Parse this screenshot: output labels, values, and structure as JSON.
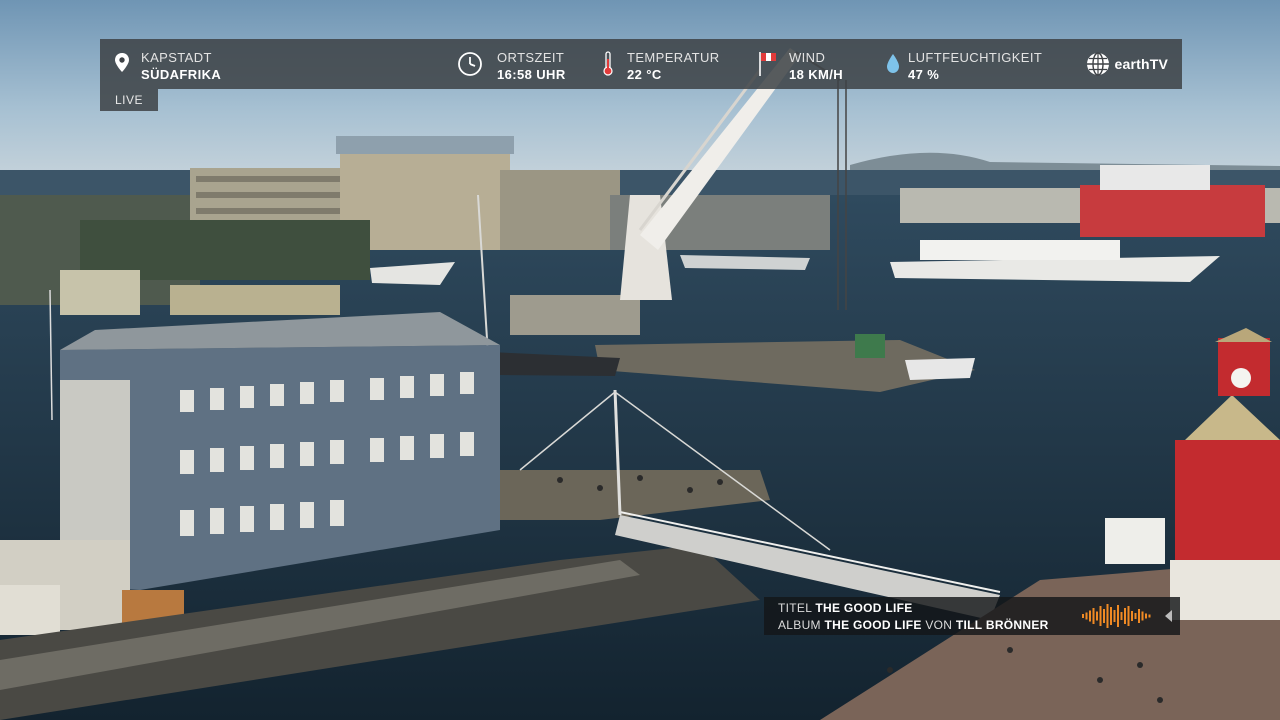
{
  "overlay": {
    "location": {
      "city": "KAPSTADT",
      "country": "SÜDAFRIKA",
      "icon": "location-pin-icon"
    },
    "status": {
      "label": "LIVE"
    },
    "local_time": {
      "label": "ORTSZEIT",
      "value": "16:58 UHR",
      "icon": "clock-icon"
    },
    "temperature": {
      "label": "TEMPERATUR",
      "value": "22 °C",
      "icon": "thermometer-icon"
    },
    "wind": {
      "label": "WIND",
      "value": "18 KM/H",
      "icon": "wind-flag-icon"
    },
    "humidity": {
      "label": "LUFTFEUCHTIGKEIT",
      "value": "47 %",
      "icon": "water-drop-icon"
    },
    "brand": {
      "name": "earthTV",
      "icon": "globe-icon"
    }
  },
  "now_playing": {
    "title_label": "TITEL",
    "title": "THE GOOD LIFE",
    "album_label": "ALBUM",
    "album": "THE GOOD LIFE",
    "by_label": "VON",
    "artist": "TILL BRÖNNER",
    "icon": "audio-waveform-icon",
    "accent_color": "#f08a24"
  },
  "colors": {
    "bar_bg": "#3e4246",
    "sky": "#a7c3d6",
    "water": "#1d3140"
  }
}
